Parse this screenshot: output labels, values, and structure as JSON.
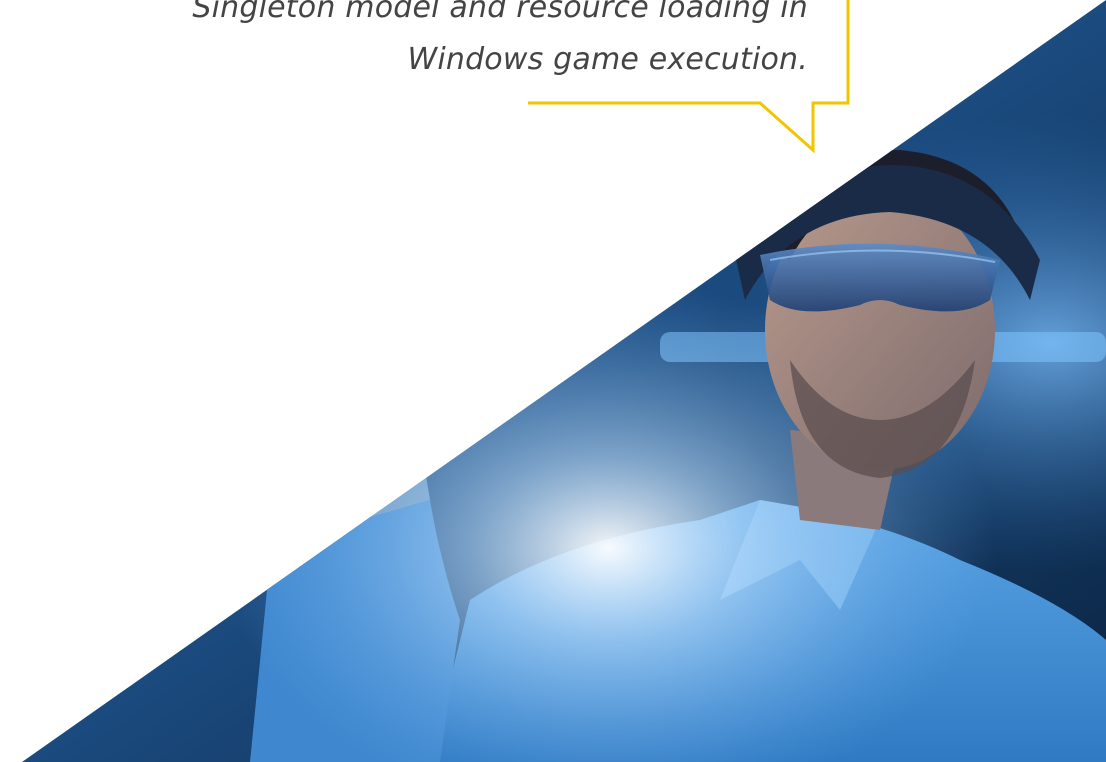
{
  "quote": {
    "line1": "Singleton model and resource loading in",
    "line2": "Windows game execution."
  },
  "colors": {
    "accent": "#F2C500",
    "text": "#444444",
    "photo_base": "#2C73B8"
  },
  "photo": {
    "icon": "man-with-ar-headset-photo"
  }
}
